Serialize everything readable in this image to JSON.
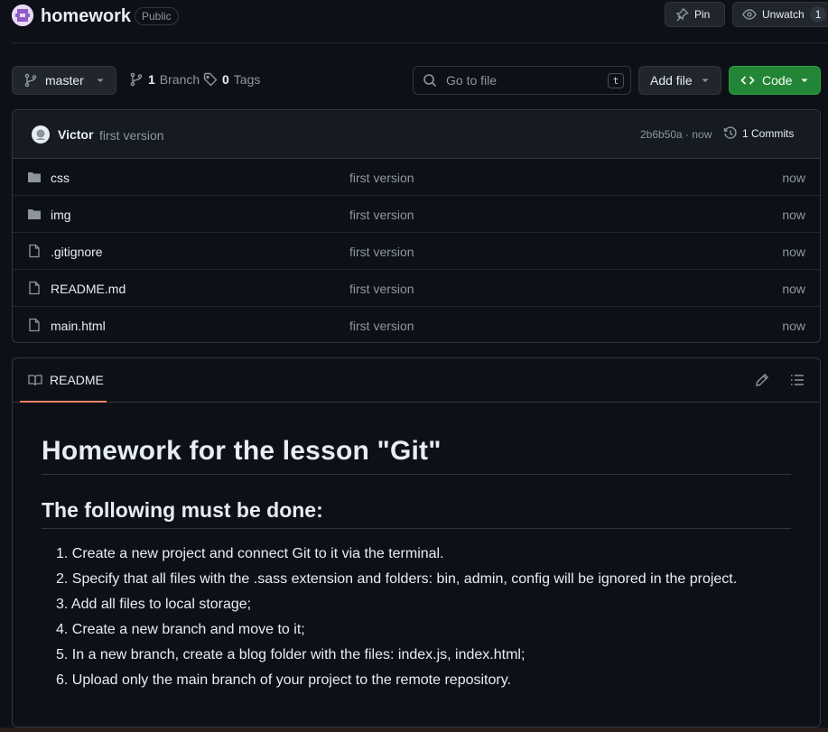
{
  "repo": {
    "name": "homework",
    "visibility": "Public",
    "pin_label": "Pin",
    "watch_label": "Unwatch",
    "watch_count": "1"
  },
  "toolbar": {
    "branch": "master",
    "branch_count": "1",
    "branch_label": "Branch",
    "tag_count": "0",
    "tag_label": "Tags",
    "search_placeholder": "Go to file",
    "search_shortcut": "t",
    "add_file_label": "Add file",
    "code_label": "Code"
  },
  "commit": {
    "author": "Victor",
    "message": "first version",
    "hash_time": "2b6b50a · now",
    "commits_label": "1 Commits"
  },
  "files": [
    {
      "name": "css",
      "type": "folder",
      "message": "first version",
      "time": "now"
    },
    {
      "name": "img",
      "type": "folder",
      "message": "first version",
      "time": "now"
    },
    {
      "name": ".gitignore",
      "type": "file",
      "message": "first version",
      "time": "now"
    },
    {
      "name": "README.md",
      "type": "file",
      "message": "first version",
      "time": "now"
    },
    {
      "name": "main.html",
      "type": "file",
      "message": "first version",
      "time": "now"
    }
  ],
  "readme": {
    "tab_label": "README",
    "title": "Homework for the lesson \"Git\"",
    "subtitle": "The following must be done:",
    "items": [
      "1. Create a new project and connect Git to it via the terminal.",
      "2. Specify that all files with the .sass extension and folders: bin, admin, config will be ignored in the project.",
      "3. Add all files to local storage;",
      "4. Create a new branch and move to it;",
      "5. In a new branch, create a blog folder with the files: index.js, index.html;",
      "6. Upload only the main branch of your project to the remote repository."
    ]
  },
  "colors": {
    "background": "#0d1117",
    "border": "#30363d",
    "accent_green": "#238636",
    "tab_underline": "#f78166",
    "muted_text": "#8d96a0"
  }
}
